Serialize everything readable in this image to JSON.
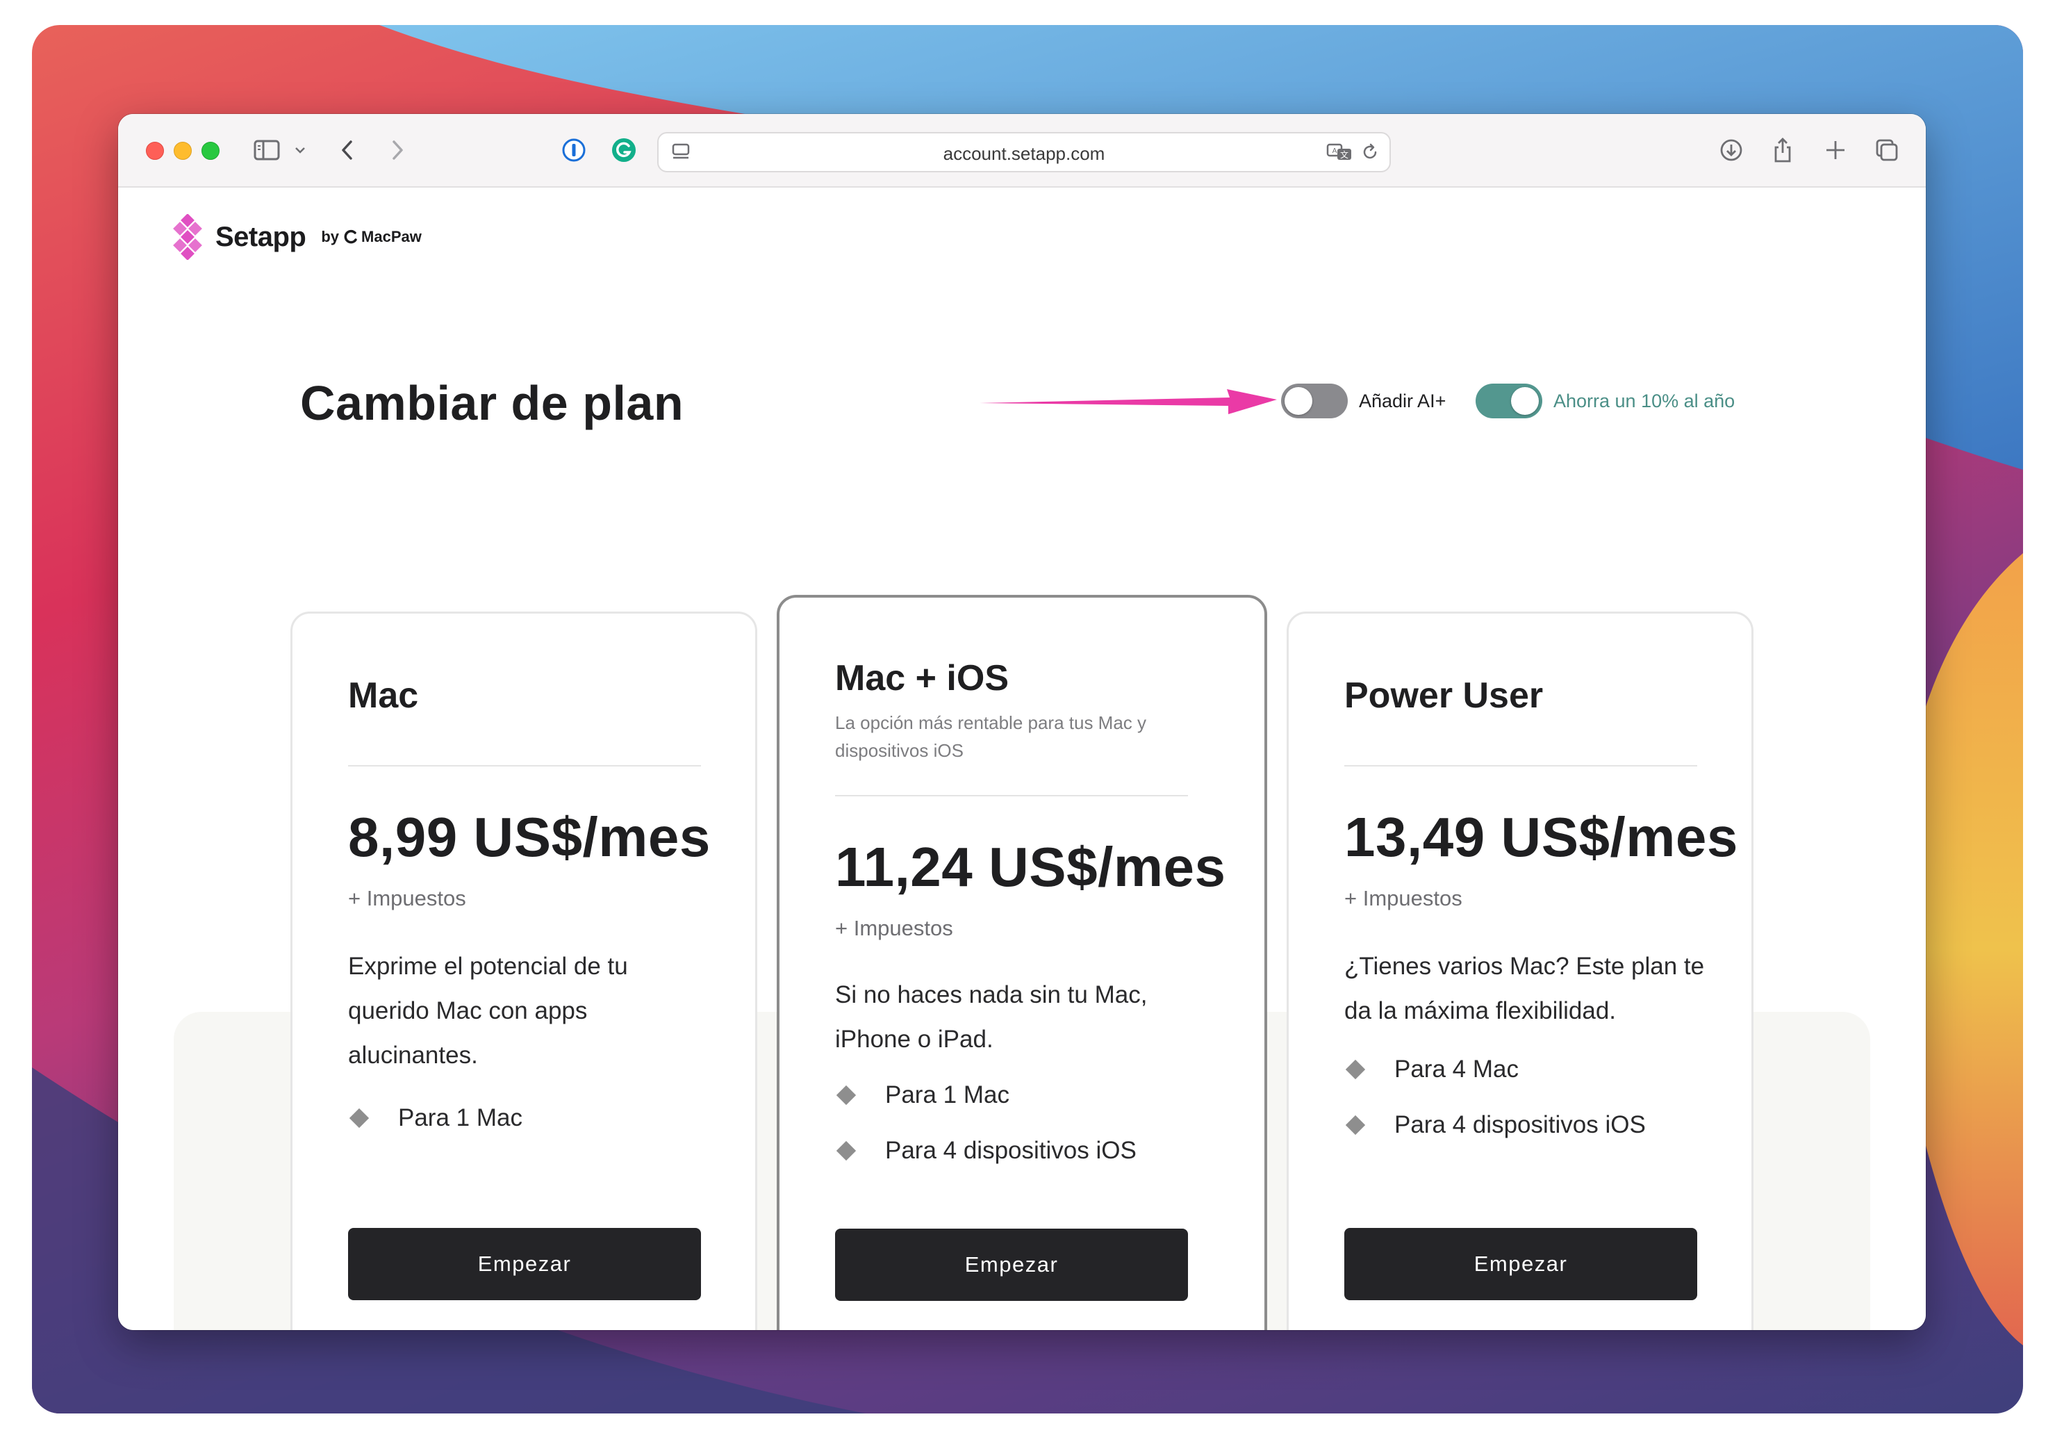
{
  "browser": {
    "url": "account.setapp.com"
  },
  "brand": {
    "name": "Setapp",
    "by": "by",
    "maker": "MacPaw"
  },
  "page": {
    "title": "Cambiar de plan",
    "ai_toggle_label": "Añadir AI+",
    "ai_toggle_on": false,
    "annual_toggle_label": "Ahorra un 10% al año",
    "annual_toggle_on": true
  },
  "plans": [
    {
      "name": "Mac",
      "subtitle": "",
      "price": "8,99 US$/mes",
      "tax": "+ Impuestos",
      "description": "Exprime el potencial de tu querido Mac con apps alucinantes.",
      "features": [
        "Para 1 Mac"
      ],
      "button": "Empezar"
    },
    {
      "name": "Mac + iOS",
      "subtitle": "La opción más rentable para tus Mac y dispositivos iOS",
      "price": "11,24 US$/mes",
      "tax": "+ Impuestos",
      "description": "Si no haces nada sin tu Mac, iPhone o iPad.",
      "features": [
        "Para 1 Mac",
        "Para 4 dispositivos iOS"
      ],
      "button": "Empezar"
    },
    {
      "name": "Power User",
      "subtitle": "",
      "price": "13,49 US$/mes",
      "tax": "+ Impuestos",
      "description": "¿Tienes varios Mac? Este plan te da la máxima flexibilidad.",
      "features": [
        "Para 4 Mac",
        "Para 4 dispositivos iOS"
      ],
      "button": "Empezar"
    }
  ],
  "colors": {
    "accent_teal": "#53978f",
    "arrow_pink": "#ea3aa6",
    "button_dark": "#242427",
    "logo_pink": "#e04fc2"
  },
  "icons": {
    "toolbar": [
      "sidebar-icon",
      "chevron-down-icon",
      "back-icon",
      "forward-icon",
      "password-manager-icon",
      "grammarly-icon",
      "page-menu-icon",
      "translate-icon",
      "reload-icon",
      "download-icon",
      "share-icon",
      "new-tab-icon",
      "tabs-overview-icon"
    ]
  }
}
